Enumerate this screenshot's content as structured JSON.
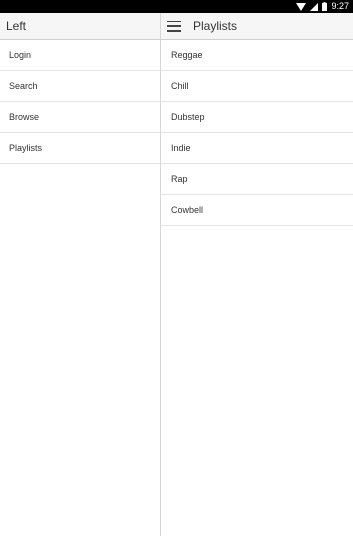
{
  "status_bar": {
    "time": "9:27",
    "icons": [
      "wifi-icon",
      "signal-icon",
      "battery-icon"
    ]
  },
  "left_pane": {
    "title": "Left",
    "items": [
      {
        "label": "Login"
      },
      {
        "label": "Search"
      },
      {
        "label": "Browse"
      },
      {
        "label": "Playlists"
      }
    ]
  },
  "right_pane": {
    "title": "Playlists",
    "menu_icon": "hamburger-menu-icon",
    "items": [
      {
        "label": "Reggae"
      },
      {
        "label": "Chill"
      },
      {
        "label": "Dubstep"
      },
      {
        "label": "Indie"
      },
      {
        "label": "Rap"
      },
      {
        "label": "Cowbell"
      }
    ]
  }
}
